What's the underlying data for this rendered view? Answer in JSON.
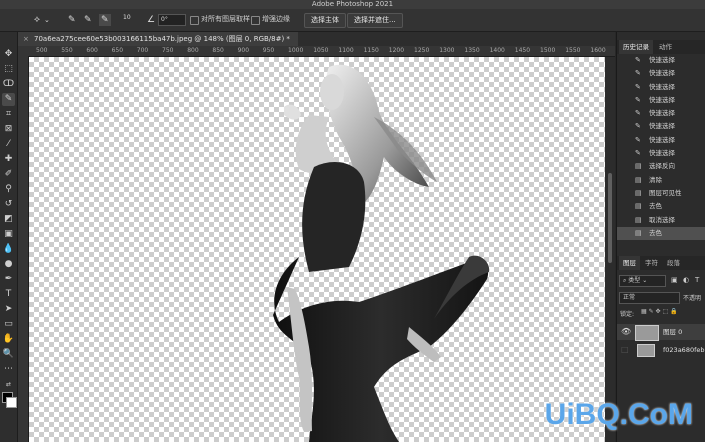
{
  "window": {
    "title": "Adobe Photoshop 2021"
  },
  "options_bar": {
    "brush_size": "10",
    "angle": "0°",
    "sample_all_layers_label": "对所有图层取样",
    "enhance_edge_label": "增强边缘",
    "select_subject_label": "选择主体",
    "select_and_mask_label": "选择并遮住..."
  },
  "document": {
    "tab_title": "70a6ea275cee60e53b003166115ba47b.jpeg @ 148% (图层 0, RGB/8#) *",
    "ruler_ticks": [
      "500",
      "550",
      "600",
      "650",
      "700",
      "750",
      "800",
      "850",
      "900",
      "950",
      "1000",
      "1050",
      "1100",
      "1150",
      "1200",
      "1250",
      "1300",
      "1350",
      "1400",
      "1450",
      "1500",
      "1550",
      "1600",
      "1650"
    ]
  },
  "history_panel": {
    "tabs": [
      "历史记录",
      "动作"
    ],
    "items": [
      {
        "label": "快速选择",
        "icon": "quick-select"
      },
      {
        "label": "快速选择",
        "icon": "quick-select"
      },
      {
        "label": "快速选择",
        "icon": "quick-select"
      },
      {
        "label": "快速选择",
        "icon": "quick-select"
      },
      {
        "label": "快速选择",
        "icon": "quick-select"
      },
      {
        "label": "快速选择",
        "icon": "quick-select"
      },
      {
        "label": "快速选择",
        "icon": "quick-select"
      },
      {
        "label": "快速选择",
        "icon": "quick-select"
      },
      {
        "label": "选择反向",
        "icon": "document"
      },
      {
        "label": "清除",
        "icon": "document"
      },
      {
        "label": "图层可见性",
        "icon": "document"
      },
      {
        "label": "去色",
        "icon": "document"
      },
      {
        "label": "取消选择",
        "icon": "document"
      },
      {
        "label": "去色",
        "icon": "document",
        "active": true
      }
    ]
  },
  "layers_panel": {
    "tabs": [
      "图层",
      "字符",
      "段落"
    ],
    "filter_label": "类型",
    "blend_mode": "正常",
    "opacity_label": "不透明",
    "lock_label": "锁定:",
    "layers": [
      {
        "name": "图层 0",
        "visible": true
      },
      {
        "name": "f023a680feb...",
        "visible": false
      }
    ]
  },
  "colors": {
    "accent": "#5aa6ea",
    "panel": "#2c2c2c",
    "toolbar": "#2e2e2e"
  },
  "watermark": {
    "text": "UiBQ.CoM"
  }
}
